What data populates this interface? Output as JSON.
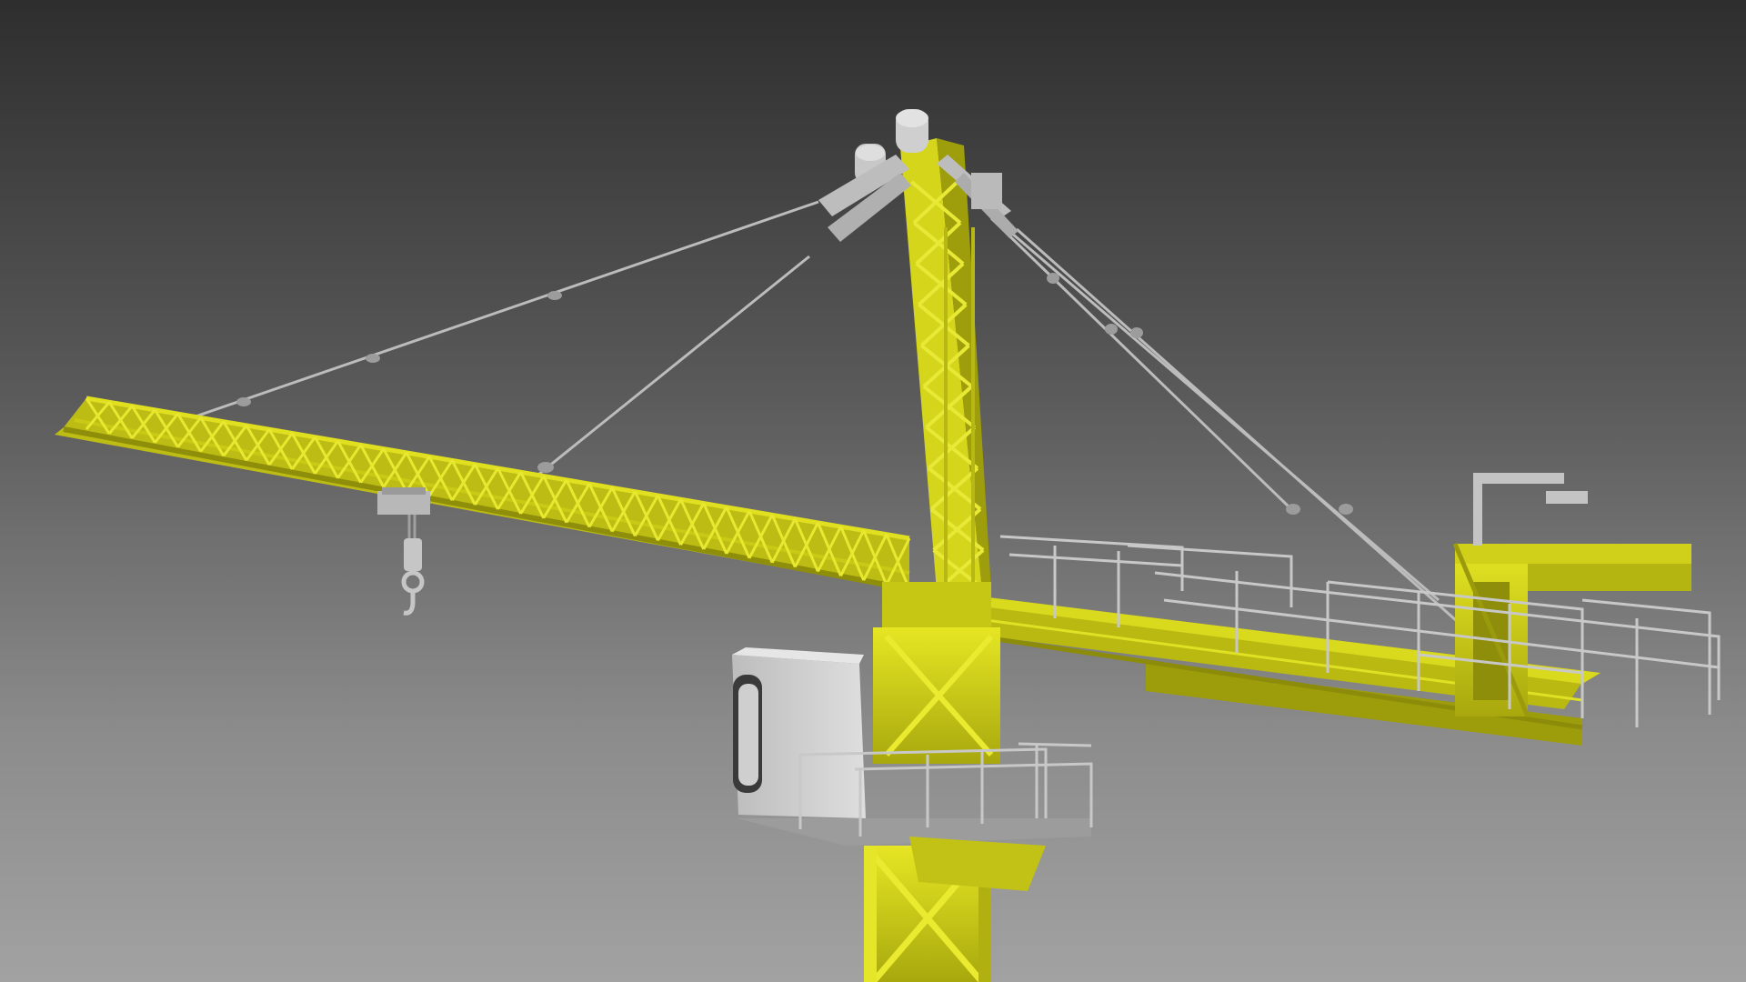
{
  "scene": {
    "subject": "tower-crane-3d-render",
    "colors": {
      "background_top": "#2e2e2e",
      "background_bottom": "#a2a2a2",
      "structure_yellow": "#d6d61a",
      "structure_yellow_dark": "#9a9a0c",
      "steel_grey": "#c4c4c4",
      "steel_grey_dark": "#8a8a8a",
      "cable": "#b9b9b9",
      "cabin_body": "#d2d2d2",
      "cabin_window": "#3a3a3a"
    }
  }
}
